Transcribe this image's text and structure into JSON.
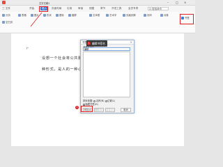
{
  "window": {
    "title": "文字文稿1"
  },
  "menu": {
    "file_label": "三 文件",
    "tabs": [
      "开始",
      "插入",
      "页面布局",
      "引用",
      "审阅",
      "视图",
      "章节",
      "开发工具",
      "会员专享"
    ],
    "search_placeholder": "Q 查找命令"
  },
  "ribbon": {
    "items": [
      "分页",
      "空白页",
      "表格",
      "图片",
      "形状",
      "图标",
      "截屏",
      "文本框",
      "艺术字",
      "页眉页脚",
      "页码",
      "对象",
      "书签"
    ]
  },
  "document": {
    "lines": [
      "设想一个社会将公共服务",
      "种形式，是人的一种心理"
    ]
  },
  "dialog": {
    "title": "书签",
    "name_label": "书签名(N):",
    "name_value": "编辑",
    "sort_label": "排序依据:",
    "sort_options": [
      "名称(N)",
      "位置(L)"
    ],
    "hidden_label": "隐藏书签(H)",
    "buttons": {
      "add": "添加(A)",
      "delete": "删除(D)",
      "goto": "定位(G)",
      "cancel": "取消"
    }
  },
  "annotations": {
    "callout_text": "编辑书签名",
    "badge_1": "1",
    "badge_2": "2"
  },
  "colors": {
    "accent": "#3a7bd5",
    "annotation_red": "#e02020"
  }
}
